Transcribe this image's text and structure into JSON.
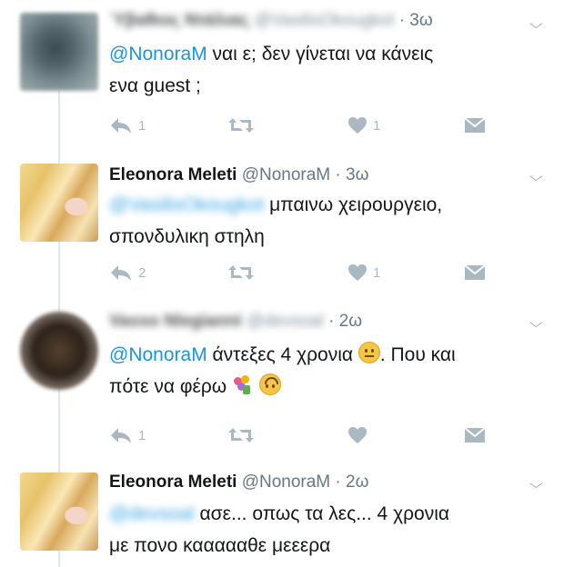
{
  "tweets": [
    {
      "author_name": "Ύβαθιος Ντάλιας",
      "handle": "@VasilisOkougkot",
      "time": "3ω",
      "reply_to": "@NonoraM",
      "text_line1": " ναι ε;  δεν γίνεται να κάνεις",
      "text_line2": "ενα guest ;",
      "reply_count": "1",
      "retweet_count": "",
      "like_count": "1"
    },
    {
      "author_name": "Eleonora Meleti",
      "handle": "@NonoraM",
      "time": "3ω",
      "reply_to": "@VasilisOkougkot",
      "text_line1": " μπαινω χειρουργειο,",
      "text_line2": "σπονδυλικη στηλη",
      "reply_count": "2",
      "retweet_count": "",
      "like_count": "1"
    },
    {
      "author_name": "Vasso Nlegianni",
      "handle": "@devsoal",
      "time": "2ω",
      "reply_to": "@NonoraM",
      "text_line1_a": " άντεξες 4 χρονια ",
      "text_line1_b": ". Που και",
      "text_line2": "πότε να φέρω ",
      "emoji_1": "neutral-face",
      "emoji_2": "bouquet",
      "emoji_3": "upside-down-face",
      "reply_count": "1",
      "retweet_count": "",
      "like_count": ""
    },
    {
      "author_name": "Eleonora Meleti",
      "handle": "@NonoraM",
      "time": "2ω",
      "reply_to": "@devsoal",
      "text_line1": " ασε... οπως τα λες... 4 χρονια",
      "text_line2": "με πονο καααααθε μεεερα"
    }
  ],
  "separator": "·",
  "icons": [
    "reply-icon",
    "retweet-icon",
    "like-icon",
    "message-icon",
    "chevron-down-icon"
  ],
  "colors": {
    "link": "#1b95e0",
    "muted": "#657786",
    "icon": "#aab8c2",
    "thread_line": "#dfe6ec"
  }
}
